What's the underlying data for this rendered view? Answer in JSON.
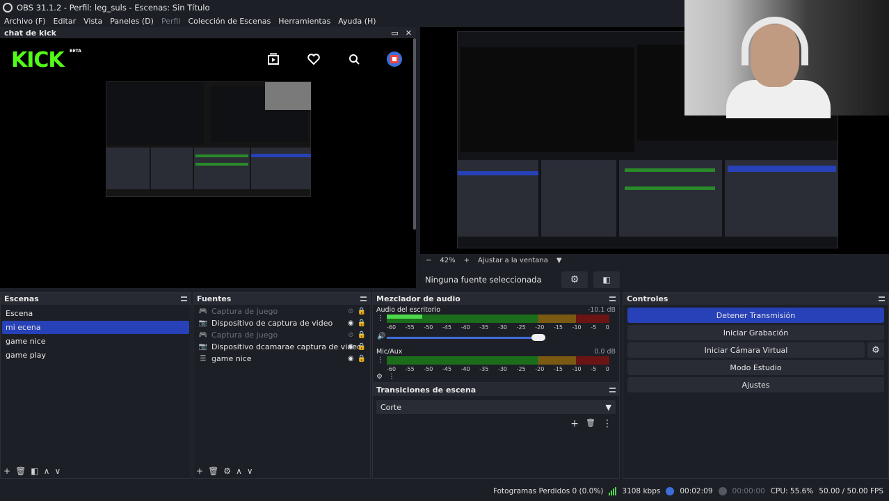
{
  "window": {
    "title": "OBS 31.1.2 - Perfil: leg_suls - Escenas: Sin Título"
  },
  "menu": [
    "Archivo (F)",
    "Editar",
    "Vista",
    "Paneles (D)",
    "Perfil",
    "Colección de Escenas",
    "Herramientas",
    "Ayuda (H)"
  ],
  "chat_dock": {
    "title": "chat de kick",
    "brand": "KICK",
    "beta": "BETA"
  },
  "preview": {
    "zoom": "42%",
    "fit_label": "Ajustar a la ventana",
    "no_source": "Ninguna fuente seleccionada"
  },
  "scenes": {
    "title": "Escenas",
    "items": [
      "Escena",
      "mi ecena",
      "game nice",
      "game play"
    ],
    "active_index": 1
  },
  "sources": {
    "title": "Fuentes",
    "items": [
      {
        "label": "Captura de juego",
        "dim": true
      },
      {
        "label": "Dispositivo de captura de video",
        "dim": false
      },
      {
        "label": "Captura de juego",
        "dim": true
      },
      {
        "label": "Dispositivo dcamarae captura de video",
        "dim": false
      },
      {
        "label": "game nice",
        "dim": false
      }
    ]
  },
  "mixer": {
    "title": "Mezclador de audio",
    "channels": [
      {
        "name": "Audio del escritorio",
        "db": "-10.1 dB",
        "level": 0.16,
        "volume": 0.68
      },
      {
        "name": "Mic/Aux",
        "db": "0.0 dB",
        "level": 0.0,
        "volume": 1.0
      }
    ],
    "ticks": [
      "-60",
      "-55",
      "-50",
      "-45",
      "-40",
      "-35",
      "-30",
      "-25",
      "-20",
      "-15",
      "-10",
      "-5",
      "0"
    ]
  },
  "transitions": {
    "title": "Transiciones de escena",
    "selected": "Corte"
  },
  "controls": {
    "title": "Controles",
    "stop_stream": "Detener Transmisión",
    "start_recording": "Iniciar Grabación",
    "virtual_cam": "Iniciar Cámara Virtual",
    "studio_mode": "Modo Estudio",
    "settings": "Ajustes"
  },
  "status": {
    "dropped": "Fotogramas Perdidos 0 (0.0%)",
    "bitrate": "3108 kbps",
    "stream_time": "00:02:09",
    "rec_time": "00:00:00",
    "cpu": "CPU: 55.6%",
    "fps": "50.00 / 50.00 FPS"
  },
  "colors": {
    "accent": "#2741b8",
    "kick_green": "#53fc18",
    "meter_green": "#4cd94c"
  }
}
